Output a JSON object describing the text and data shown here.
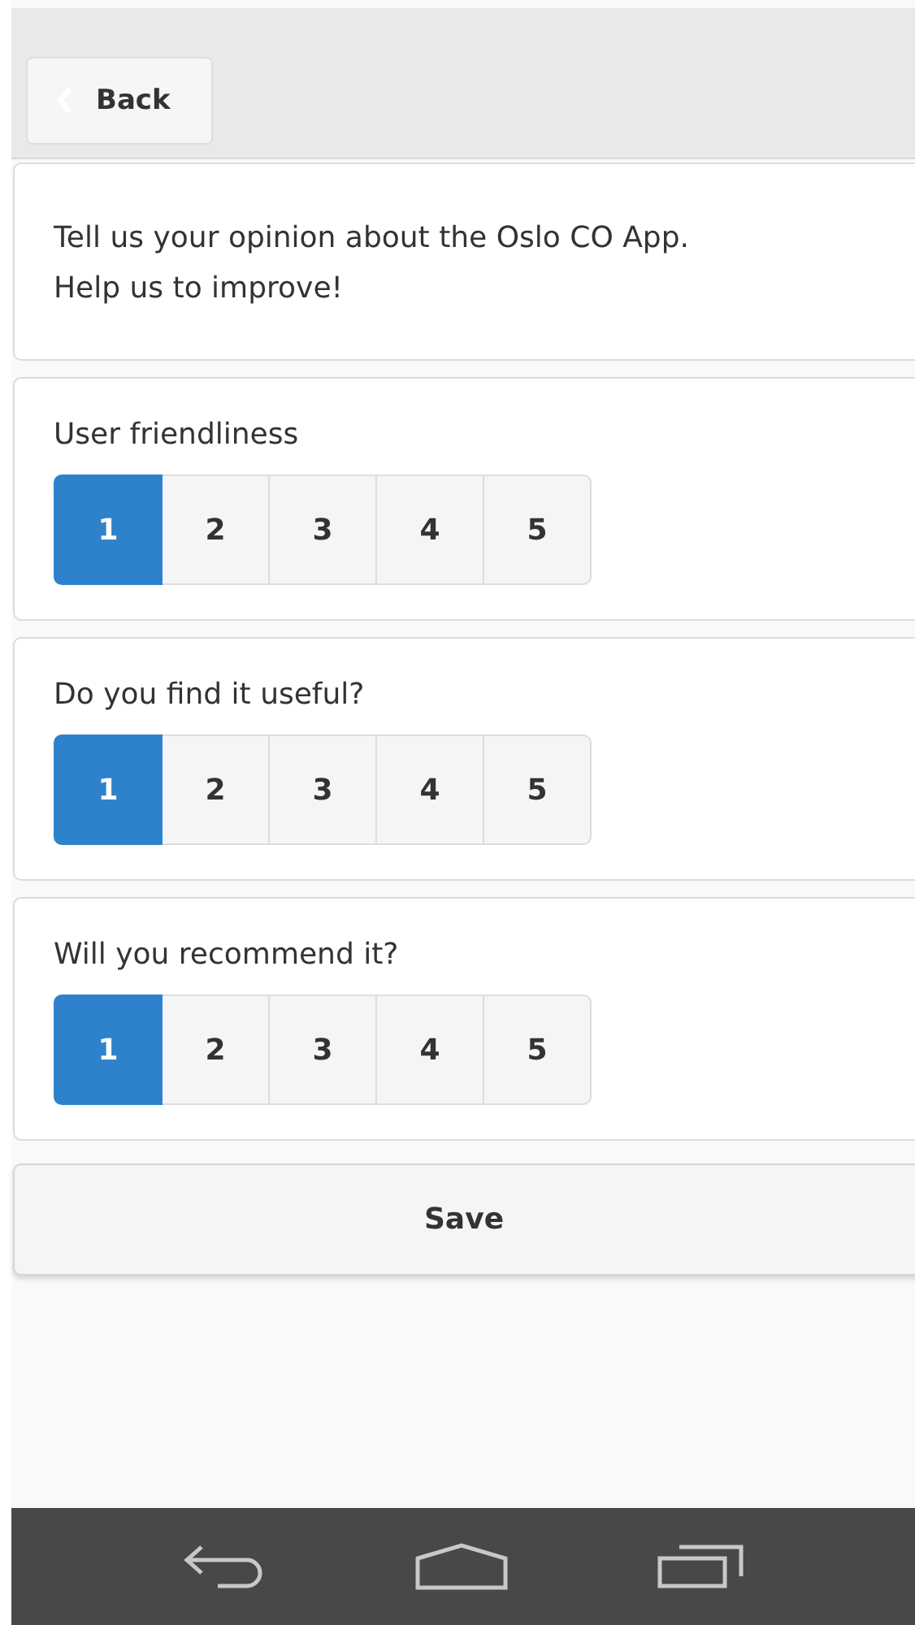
{
  "header": {
    "back_button": "Back"
  },
  "intro": "Tell us your opinion about the Oslo CO App.\nHelp us to improve!",
  "questions": [
    {
      "label": "User friendliness",
      "options": [
        {
          "label": "1",
          "selected": true
        },
        {
          "label": "2",
          "selected": false
        },
        {
          "label": "3",
          "selected": false
        },
        {
          "label": "4",
          "selected": false
        },
        {
          "label": "5",
          "selected": false
        }
      ]
    },
    {
      "label": "Do you find it useful?",
      "options": [
        {
          "label": "1",
          "selected": true
        },
        {
          "label": "2",
          "selected": false
        },
        {
          "label": "3",
          "selected": false
        },
        {
          "label": "4",
          "selected": false
        },
        {
          "label": "5",
          "selected": false
        }
      ]
    },
    {
      "label": "Will you recommend it?",
      "options": [
        {
          "label": "1",
          "selected": true
        },
        {
          "label": "2",
          "selected": false
        },
        {
          "label": "3",
          "selected": false
        },
        {
          "label": "4",
          "selected": false
        },
        {
          "label": "5",
          "selected": false
        }
      ]
    }
  ],
  "save_button": "Save"
}
